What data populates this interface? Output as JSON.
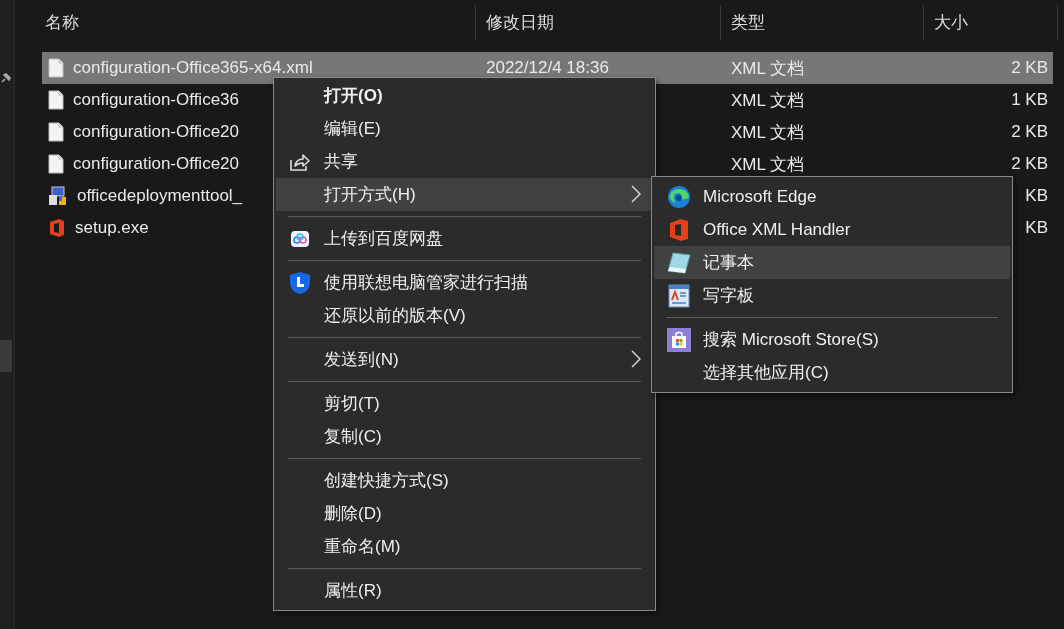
{
  "columns": [
    {
      "label": "名称"
    },
    {
      "label": "修改日期"
    },
    {
      "label": "类型"
    },
    {
      "label": "大小"
    }
  ],
  "files": [
    {
      "name": "configuration-Office365-x64.xml",
      "date": "2022/12/4 18:36",
      "type": "XML 文档",
      "size": "2 KB",
      "selected": true
    },
    {
      "name": "configuration-Office36",
      "type": "XML 文档",
      "size": "1 KB",
      "selected": false
    },
    {
      "name": "configuration-Office20",
      "type": "XML 文档",
      "size": "2 KB",
      "selected": false
    },
    {
      "name": "configuration-Office20",
      "type": "XML 文档",
      "size": "2 KB",
      "selected": false
    },
    {
      "name": "officedeploymenttool_",
      "size": "KB",
      "selected": false
    },
    {
      "name": "setup.exe",
      "size": "KB",
      "selected": false
    }
  ],
  "context_menu": {
    "items": [
      {
        "kind": "item",
        "label": "打开(O)",
        "default": true,
        "submenu": false,
        "selected": false
      },
      {
        "kind": "item",
        "label": "编辑(E)",
        "default": false,
        "submenu": false,
        "selected": false
      },
      {
        "kind": "item",
        "label": "共享",
        "default": false,
        "submenu": false,
        "selected": false
      },
      {
        "kind": "item",
        "label": "打开方式(H)",
        "default": false,
        "submenu": true,
        "selected": true
      },
      {
        "kind": "separator"
      },
      {
        "kind": "item",
        "label": "上传到百度网盘",
        "default": false,
        "submenu": false,
        "selected": false
      },
      {
        "kind": "separator"
      },
      {
        "kind": "item",
        "label": "使用联想电脑管家进行扫描",
        "default": false,
        "submenu": false,
        "selected": false
      },
      {
        "kind": "item",
        "label": "还原以前的版本(V)",
        "default": false,
        "submenu": false,
        "selected": false
      },
      {
        "kind": "separator"
      },
      {
        "kind": "item",
        "label": "发送到(N)",
        "default": false,
        "submenu": true,
        "selected": false
      },
      {
        "kind": "separator"
      },
      {
        "kind": "item",
        "label": "剪切(T)",
        "default": false,
        "submenu": false,
        "selected": false
      },
      {
        "kind": "item",
        "label": "复制(C)",
        "default": false,
        "submenu": false,
        "selected": false
      },
      {
        "kind": "separator"
      },
      {
        "kind": "item",
        "label": "创建快捷方式(S)",
        "default": false,
        "submenu": false,
        "selected": false
      },
      {
        "kind": "item",
        "label": "删除(D)",
        "default": false,
        "submenu": false,
        "selected": false
      },
      {
        "kind": "item",
        "label": "重命名(M)",
        "default": false,
        "submenu": false,
        "selected": false
      },
      {
        "kind": "separator"
      },
      {
        "kind": "item",
        "label": "属性(R)",
        "default": false,
        "submenu": false,
        "selected": false
      }
    ]
  },
  "open_with_menu": {
    "items": [
      {
        "kind": "item",
        "label": "Microsoft Edge",
        "selected": false
      },
      {
        "kind": "item",
        "label": "Office XML Handler",
        "selected": false
      },
      {
        "kind": "item",
        "label": "记事本",
        "selected": true
      },
      {
        "kind": "item",
        "label": "写字板",
        "selected": false
      },
      {
        "kind": "separator"
      },
      {
        "kind": "item",
        "label": "搜索 Microsoft Store(S)",
        "selected": false
      },
      {
        "kind": "item",
        "label": "选择其他应用(C)",
        "selected": false
      }
    ]
  }
}
